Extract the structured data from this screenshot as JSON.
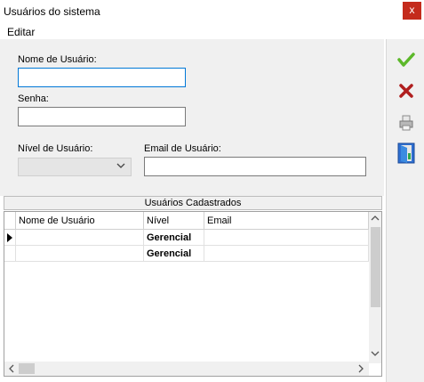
{
  "window": {
    "title": "Usuários do sistema",
    "close_glyph": "x"
  },
  "menu": {
    "items": [
      "Editar"
    ]
  },
  "form": {
    "username_label": "Nome de Usuário:",
    "username_value": "",
    "password_label": "Senha:",
    "password_value": "",
    "level_label": "Nível de Usuário:",
    "level_value": "",
    "email_label": "Email de Usuário:",
    "email_value": ""
  },
  "toolbar": {
    "confirm_icon": "checkmark-icon",
    "cancel_icon": "x-icon",
    "print_icon": "printer-icon",
    "exit_icon": "exit-door-icon",
    "confirm_color": "#5cb82a",
    "cancel_color": "#b01e1e"
  },
  "grid": {
    "caption": "Usuários Cadastrados",
    "columns": [
      "Nome de Usuário",
      "Nível",
      "Email"
    ],
    "rows": [
      {
        "name": "",
        "level": "Gerencial",
        "email": "",
        "current": true
      },
      {
        "name": "",
        "level": "Gerencial",
        "email": "",
        "current": false
      }
    ]
  }
}
